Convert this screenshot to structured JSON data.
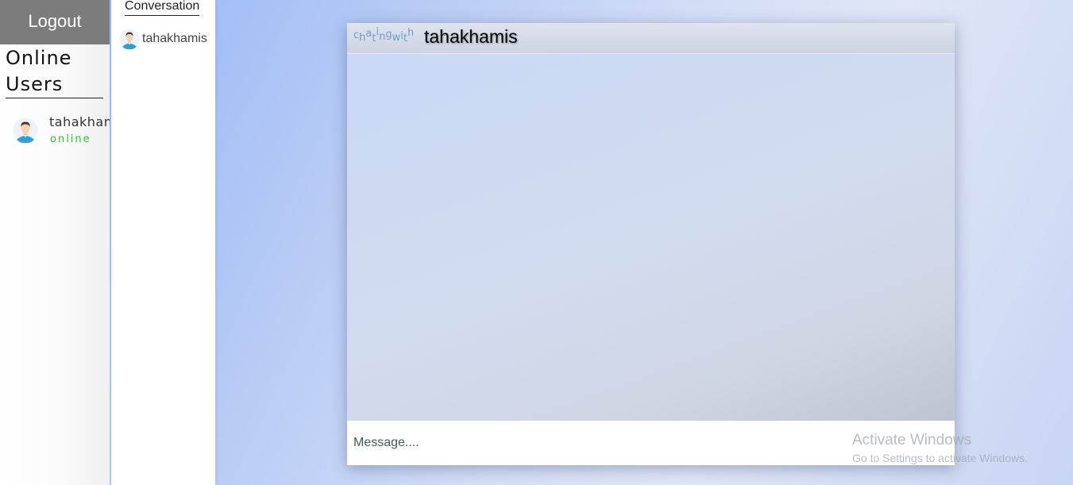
{
  "sidebar": {
    "logout_label": "Logout",
    "online_title": "Online Users",
    "online_users": [
      {
        "name": "tahakhamis",
        "status": "online",
        "avatar_icon": "user-avatar-icon"
      }
    ],
    "status_color": "#34c234"
  },
  "conversation": {
    "title": "Conversation",
    "items": [
      {
        "name": "tahakhamis",
        "avatar_icon": "user-avatar-icon"
      }
    ]
  },
  "chat": {
    "prefix": "chatingwith",
    "partner_name": "tahakhamis",
    "message_placeholder": "Message...."
  },
  "watermark": {
    "title": "Activate Windows",
    "subtitle": "Go to Settings to activate Windows."
  }
}
